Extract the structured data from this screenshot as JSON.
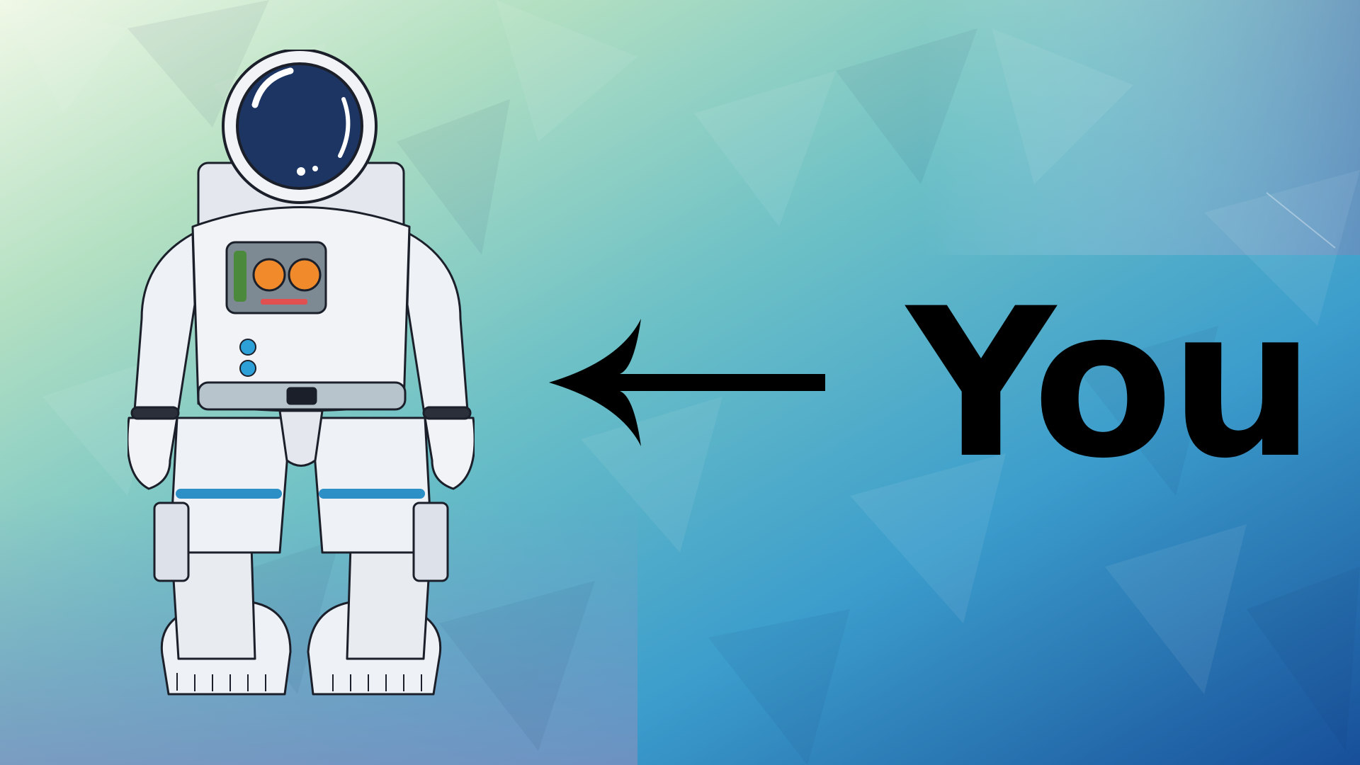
{
  "slide": {
    "label": "You",
    "illustration": "astronaut",
    "pointer_icon": "arrow-left-icon"
  },
  "colors": {
    "bg_top_left": "#e6f5e4",
    "bg_center": "#7fcfc8",
    "bg_right": "#3f9ccc",
    "bg_bottom_right": "#1b5ea6",
    "suit_white": "#f1f3f6",
    "suit_shade": "#c4cbd7",
    "visor": "#1c3563",
    "leg_band": "#2c8fc6",
    "label_color": "#000000"
  }
}
